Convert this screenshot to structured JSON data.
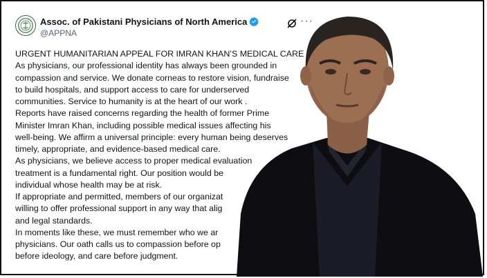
{
  "account": {
    "name": "Assoc. of Pakistani Physicians of North America",
    "handle": "@APPNA"
  },
  "icons": {
    "verified": "verified-badge-icon",
    "grok": "grok-icon",
    "more": "more-options-icon"
  },
  "colors": {
    "verified": "#1d9bf0",
    "text": "#0f1419",
    "secondary": "#536471",
    "logo_green": "#2e6b3a"
  },
  "tweet": {
    "lines": [
      "URGENT HUMANITARIAN APPEAL FOR IMRAN KHAN’S MEDICAL CARE",
      "As physicians, our professional identity has always been grounded in",
      "compassion and service. We donate corneas to restore vision, fundraise",
      "to build hospitals, and support access to care for underserved",
      "communities. Service to humanity is at the heart of our work .",
      "Reports have raised concerns regarding the health of former Prime",
      "Minister Imran Khan, including possible medical issues affecting his",
      "well-being. We affirm a universal principle: every human being deserves",
      "timely, appropriate, and evidence-based medical care.",
      "As physicians, we believe access to proper medical evaluation",
      "treatment is a fundamental right. Our position would be",
      "individual whose health may be at risk.",
      "If appropriate and permitted, members of our organizat",
      "willing to offer professional support in any way that alig",
      "and legal standards.",
      "In moments like these, we must remember who we ar",
      "physicians. Our oath calls us to compassion before op",
      "before ideology, and care before judgment."
    ]
  }
}
